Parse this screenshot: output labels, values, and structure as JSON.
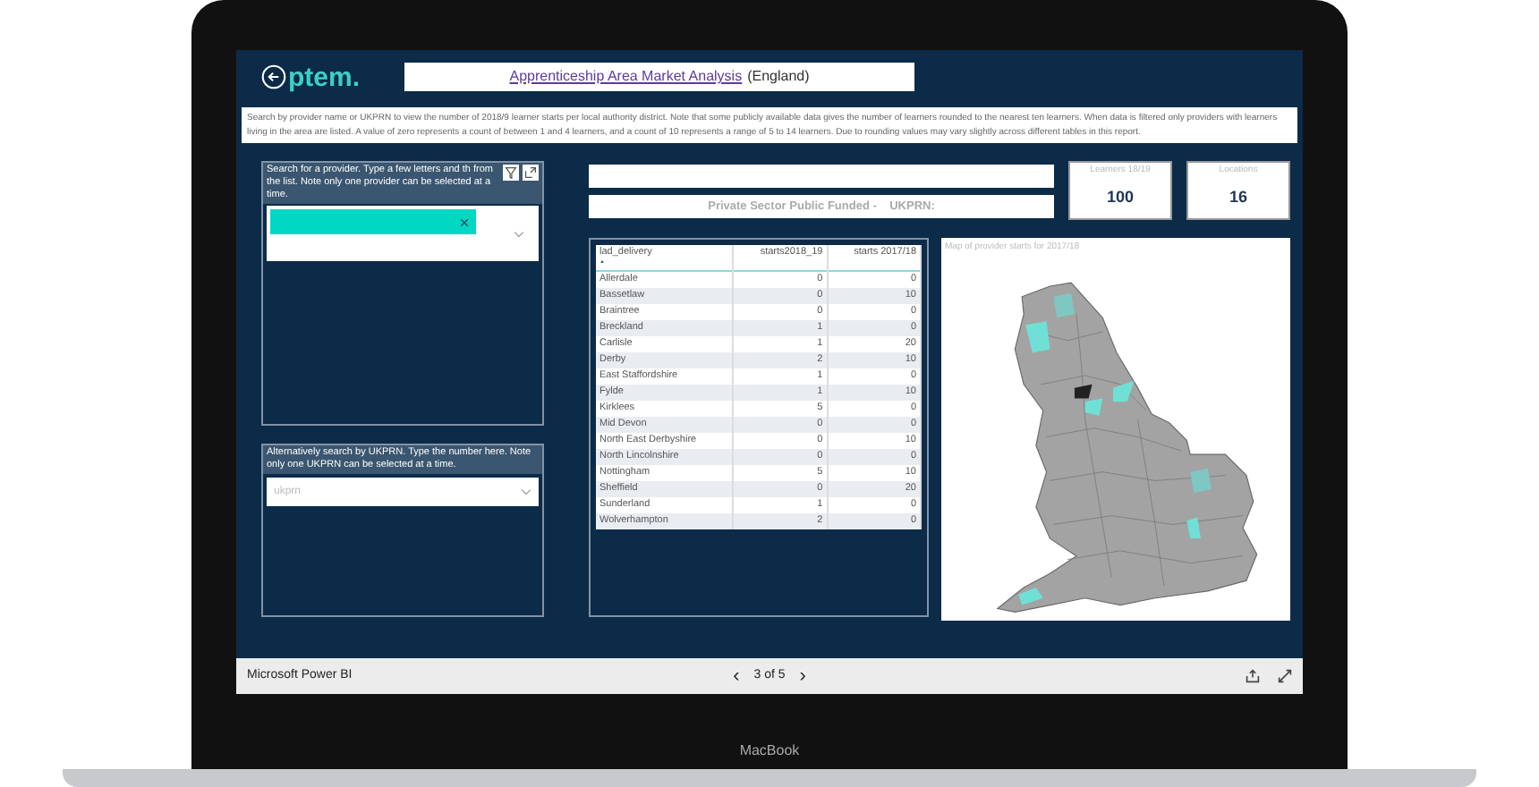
{
  "report": {
    "logo": "ptem.",
    "title_link": "Apprenticeship Area Market Analysis",
    "title_suffix": "(England)",
    "description": "Search by provider name or UKPRN to view the number of 2018/9 learner starts per local authority district.  Note that some publicly available data gives the number of learners rounded to the nearest ten learners.  When data is filtered only providers with learners living in the area are listed.  A value of zero represents a count of between 1 and 4 learners, and a count of 10 represents a range of 5 to 14 learners.  Due to rounding values may vary slightly across different tables in this report."
  },
  "provider_slicer": {
    "header": "Search for a provider. Type a few letters and th from the list. Note only one provider can be selected at a time.",
    "selected_chip": true
  },
  "ukprn_slicer": {
    "header": "Alternatively search by UKPRN. Type the number here. Note only one UKPRN can be selected at a time.",
    "placeholder": "ukprn"
  },
  "provider_info": {
    "line": "Private Sector Public Funded -    UKPRN:"
  },
  "cards": [
    {
      "label": "Learners 18/19",
      "value": "100"
    },
    {
      "label": "Locations",
      "value": "16"
    }
  ],
  "table": {
    "columns": [
      "lad_delivery",
      "starts2018_19",
      "starts 2017/18"
    ],
    "sort_mark": "▲",
    "rows": [
      [
        "Allerdale",
        "0",
        "0"
      ],
      [
        "Bassetlaw",
        "0",
        "10"
      ],
      [
        "Braintree",
        "0",
        "0"
      ],
      [
        "Breckland",
        "1",
        "0"
      ],
      [
        "Carlisle",
        "1",
        "20"
      ],
      [
        "Derby",
        "2",
        "10"
      ],
      [
        "East Staffordshire",
        "1",
        "0"
      ],
      [
        "Fylde",
        "1",
        "10"
      ],
      [
        "Kirklees",
        "5",
        "0"
      ],
      [
        "Mid Devon",
        "0",
        "0"
      ],
      [
        "North East Derbyshire",
        "0",
        "10"
      ],
      [
        "North Lincolnshire",
        "0",
        "0"
      ],
      [
        "Nottingham",
        "5",
        "10"
      ],
      [
        "Sheffield",
        "0",
        "20"
      ],
      [
        "Sunderland",
        "1",
        "0"
      ],
      [
        "Wolverhampton",
        "2",
        "0"
      ]
    ]
  },
  "map": {
    "title": "Map of provider starts for 2017/18"
  },
  "footer": {
    "app": "Microsoft Power BI",
    "prev": "‹",
    "page": "3 of 5",
    "next": "›"
  },
  "laptop": {
    "brand": "MacBook"
  }
}
